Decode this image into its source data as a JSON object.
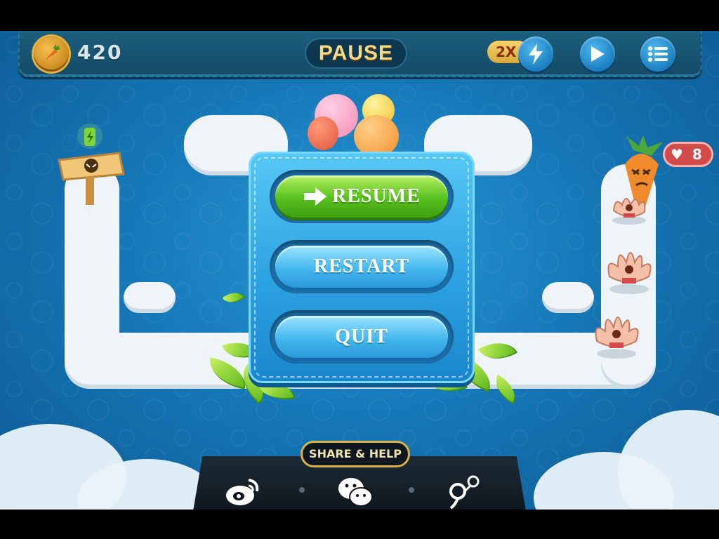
{
  "hud": {
    "gold": "420",
    "pause_label": "PAUSE",
    "speed_label": "2X"
  },
  "dialog": {
    "resume_label": "RESUME",
    "restart_label": "RESTART",
    "quit_label": "QUIT"
  },
  "lives": "8",
  "share": {
    "label": "SHARE & HELP",
    "icons": [
      "weibo-icon",
      "wechat-icon",
      "tencent-weibo-icon"
    ]
  },
  "colors": {
    "resume_green": "#58c01e",
    "dialog_blue": "#2a9fe0",
    "hud_bg": "#1b5f7e",
    "gold_text": "#f1d98a"
  }
}
